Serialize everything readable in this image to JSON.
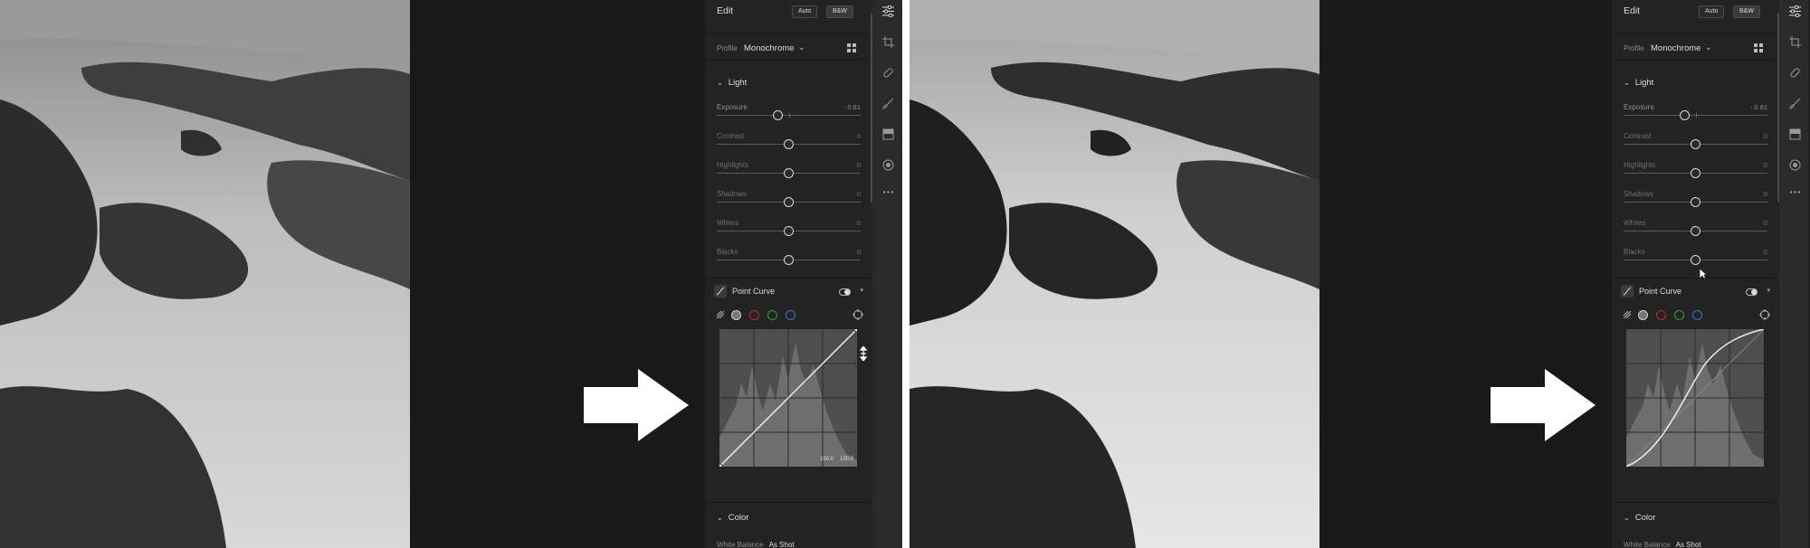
{
  "edit": {
    "title": "Edit",
    "auto_label": "Auto",
    "bw_label": "B&W",
    "profile_label": "Profile",
    "profile_value": "Monochrome",
    "light_label": "Light",
    "color_label": "Color",
    "white_balance_label": "White Balance",
    "white_balance_value": "As Shot",
    "point_curve_label": "Point Curve",
    "curve_label_left": "100.0",
    "curve_label_right": "100.0"
  },
  "before": {
    "sliders": [
      {
        "name": "Exposure",
        "value": "- 0.81",
        "level": 0.43
      },
      {
        "name": "Contrast",
        "value": "0",
        "level": 0.5
      },
      {
        "name": "Highlights",
        "value": "0",
        "level": 0.5
      },
      {
        "name": "Shadows",
        "value": "0",
        "level": 0.5
      },
      {
        "name": "Whites",
        "value": "0",
        "level": 0.5
      },
      {
        "name": "Blacks",
        "value": "0",
        "level": 0.5
      }
    ]
  },
  "after": {
    "sliders": [
      {
        "name": "Exposure",
        "value": "- 0.81",
        "level": 0.43
      },
      {
        "name": "Contrast",
        "value": "0",
        "level": 0.5
      },
      {
        "name": "Highlights",
        "value": "0",
        "level": 0.5
      },
      {
        "name": "Shadows",
        "value": "0",
        "level": 0.5
      },
      {
        "name": "Whites",
        "value": "0",
        "level": 0.5
      },
      {
        "name": "Blacks",
        "value": "0",
        "level": 0.5
      }
    ]
  },
  "colors": {
    "channel_white": "#d0d0d0",
    "channel_red": "#c0282b",
    "channel_green": "#2e9c3a",
    "channel_blue": "#3a6fd8",
    "panel_bg": "#232323",
    "app_bg": "#191919"
  },
  "icons": [
    "sliders-icon",
    "crop-icon",
    "healing-icon",
    "brush-icon",
    "gradient-icon",
    "radial-icon",
    "more-icon",
    "grid-icon",
    "curve-icon",
    "toggle-icon",
    "target-icon",
    "arrow-right-icon",
    "resize-cursor-icon",
    "pointer-cursor-icon"
  ]
}
